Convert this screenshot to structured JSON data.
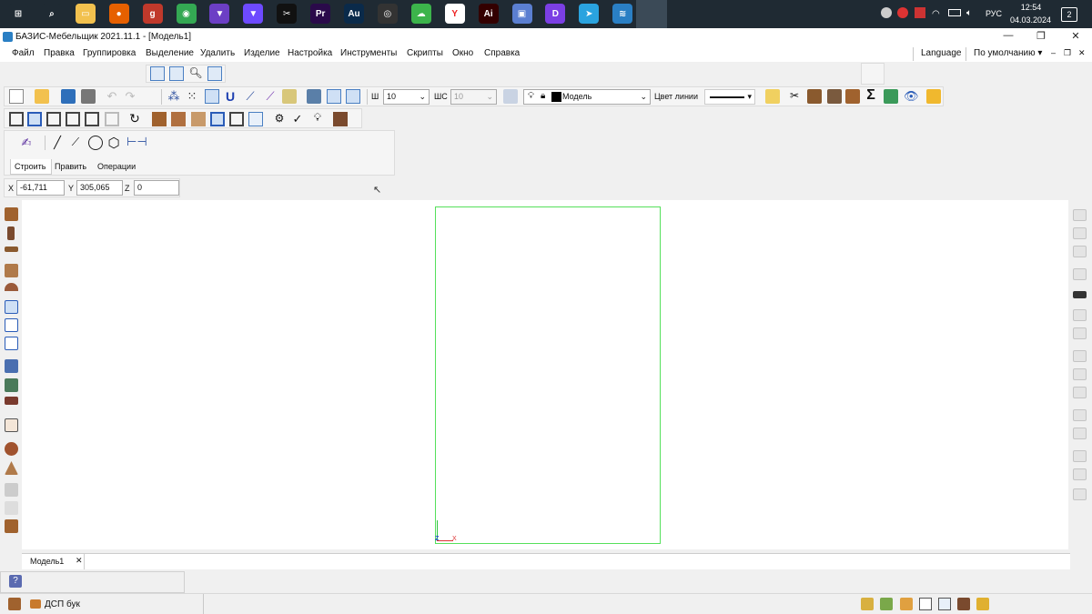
{
  "taskbar": {
    "apps": [
      {
        "icon": "windows-start-icon",
        "color": "#1f2a33"
      },
      {
        "icon": "search-icon",
        "color": "#1f2a33"
      },
      {
        "icon": "file-explorer-icon",
        "color": "#f2c14e"
      },
      {
        "icon": "firefox-icon",
        "color": "#e66000"
      },
      {
        "icon": "g-app-icon",
        "color": "#c0392b"
      },
      {
        "icon": "chrome-icon",
        "color": "#34a853"
      },
      {
        "icon": "vpn-icon",
        "color": "#6c3fc5"
      },
      {
        "icon": "proton-icon",
        "color": "#6d4aff"
      },
      {
        "icon": "capcut-icon",
        "color": "#111111"
      },
      {
        "icon": "premiere-icon",
        "color": "#2a0a4a"
      },
      {
        "icon": "audition-icon",
        "color": "#0a2a4a"
      },
      {
        "icon": "obs-icon",
        "color": "#333333"
      },
      {
        "icon": "cloud-app-icon",
        "color": "#3cb44b"
      },
      {
        "icon": "yandex-browser-icon",
        "color": "#ffffff"
      },
      {
        "icon": "illustrator-icon",
        "color": "#330000"
      },
      {
        "icon": "save-app-icon",
        "color": "#5b7fd1"
      },
      {
        "icon": "d-app-icon",
        "color": "#7b3fe4"
      },
      {
        "icon": "telegram-icon",
        "color": "#2aa3df"
      },
      {
        "icon": "bazis-icon",
        "color": "#2a7fc4"
      }
    ],
    "lang": "РУС",
    "time": "12:54",
    "date": "04.03.2024",
    "notifications": "2"
  },
  "window": {
    "title": "БАЗИС-Мебельщик 2021.11.1 - [Модель1]"
  },
  "menu": {
    "items": [
      "Файл",
      "Правка",
      "Группировка",
      "Выделение",
      "Удалить",
      "Изделие",
      "Настройка",
      "Инструменты",
      "Скрипты",
      "Окно",
      "Справка"
    ],
    "language": "Language",
    "default_label": "По умолчанию"
  },
  "toolbar": {
    "w_label": "Ш",
    "w_value": "10",
    "ws_label": "ШС",
    "ws_value": "10",
    "layer_value": "Модель",
    "line_color_label": "Цвет линии",
    "layer_color": "#000000"
  },
  "build_panel": {
    "tabs": [
      "Строить",
      "Править",
      "Операции"
    ]
  },
  "coords": {
    "x_label": "X",
    "x_value": "-61,711",
    "y_label": "Y",
    "y_value": "305,065",
    "z_label": "Z",
    "z_value": "0"
  },
  "canvas": {
    "frame_color": "#55e05b",
    "axis_labels": {
      "z": "Z",
      "x": "X"
    }
  },
  "tabs": {
    "model_tab": "Модель1"
  },
  "status": {
    "material": "ДСП бук"
  }
}
